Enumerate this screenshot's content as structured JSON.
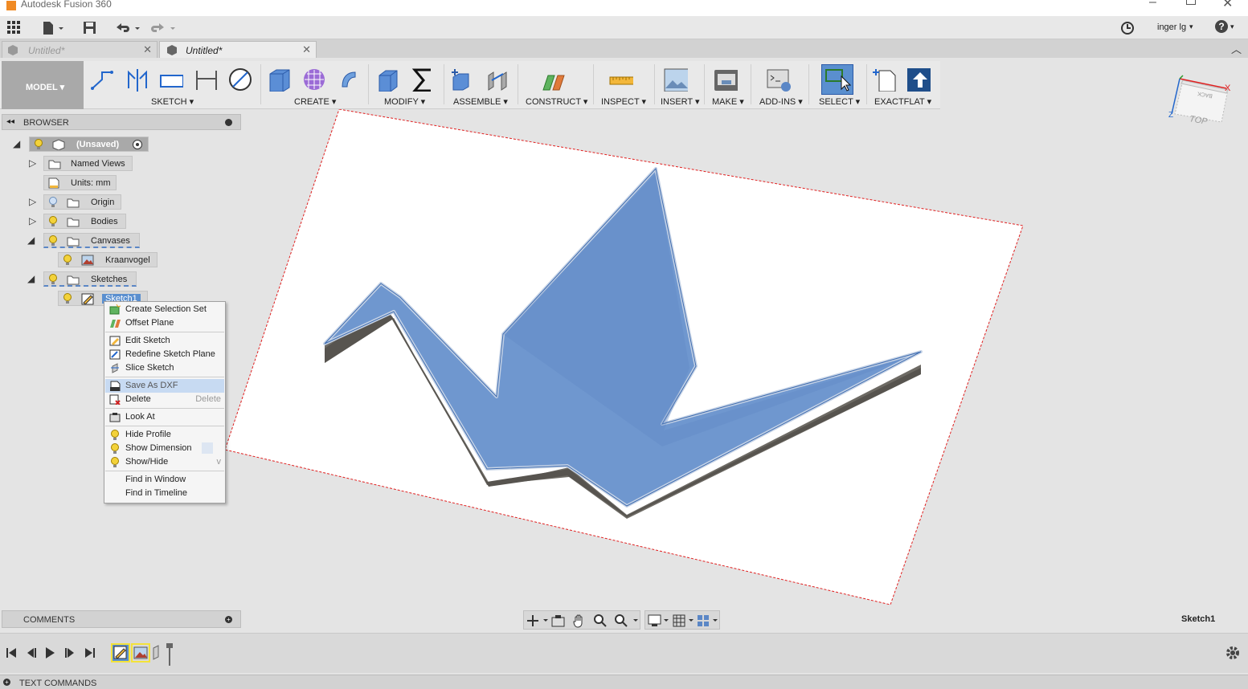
{
  "window": {
    "title": "Autodesk Fusion 360"
  },
  "qat": {
    "user": "inger lg",
    "help": "?"
  },
  "tabs": [
    {
      "label": "Untitled*"
    },
    {
      "label": "Untitled*"
    }
  ],
  "toolbar": {
    "model": "MODEL ▾",
    "groups": [
      "SKETCH ▾",
      "CREATE ▾",
      "MODIFY ▾",
      "ASSEMBLE ▾",
      "CONSTRUCT ▾",
      "INSPECT ▾",
      "INSERT ▾",
      "MAKE ▾",
      "ADD-INS ▾",
      "SELECT ▾",
      "EXACTFLAT ▾"
    ]
  },
  "browser": {
    "title": "BROWSER",
    "nodes": {
      "root": "(Unsaved)",
      "named_views": "Named Views",
      "units": "Units: mm",
      "origin": "Origin",
      "bodies": "Bodies",
      "canvases": "Canvases",
      "kraanvogel": "Kraanvogel",
      "sketches": "Sketches",
      "sketch1": "Sketch1"
    }
  },
  "context_menu": {
    "items": [
      {
        "label": "Create Selection Set"
      },
      {
        "label": "Offset Plane"
      },
      {
        "label": "Edit Sketch"
      },
      {
        "label": "Redefine Sketch Plane"
      },
      {
        "label": "Slice Sketch"
      },
      {
        "label": "Save As DXF"
      },
      {
        "label": "Delete",
        "shortcut": "Delete"
      },
      {
        "label": "Look At"
      },
      {
        "label": "Hide Profile"
      },
      {
        "label": "Show Dimension"
      },
      {
        "label": "Show/Hide",
        "shortcut": "v"
      },
      {
        "label": "Find in Window"
      },
      {
        "label": "Find in Timeline"
      }
    ]
  },
  "viewcube": {
    "top": "TOP",
    "back": "BACK",
    "x": "X",
    "z": "Z"
  },
  "comments": {
    "title": "COMMENTS"
  },
  "status": {
    "active": "Sketch1"
  },
  "textcommands": {
    "title": "TEXT COMMANDS"
  },
  "colors": {
    "accent": "#5b87c6",
    "highlight": "#c7daf2",
    "selected": "#5a8fcf"
  }
}
